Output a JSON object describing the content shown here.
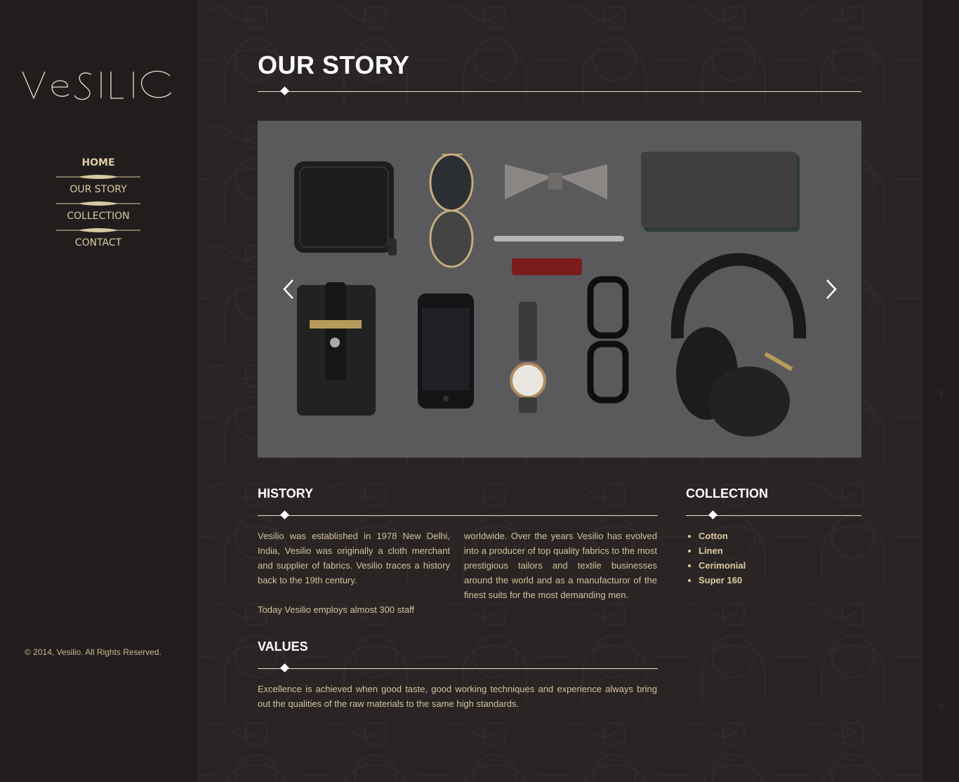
{
  "brand": {
    "logo_text": "VESILIO"
  },
  "nav": {
    "items": [
      {
        "label": "HOME",
        "active": true
      },
      {
        "label": "OUR STORY",
        "active": false
      },
      {
        "label": "COLLECTION",
        "active": false
      },
      {
        "label": "CONTACT",
        "active": false
      }
    ]
  },
  "footer": {
    "copyright": "© 2014, Vesilio. All Rights Reserved."
  },
  "page": {
    "title": "OUR STORY"
  },
  "slider": {
    "prev_icon": "chevron-left-icon",
    "next_icon": "chevron-right-icon"
  },
  "history": {
    "heading": "HISTORY",
    "col1": "Vesilio was established in 1978 New Delhi, India, Vesilio was originally a cloth merchant and supplier of fabrics. Vesilio traces a history back to the 19th century.",
    "col1b": "Today Vesilio employs almost 300 staff",
    "col2": "worldwide. Over the years Vesilio has evolved into a producer of top quality fabrics to the most prestigious tailors and textile businesses around the world and as a manufacturor of the finest suits for the most demanding men."
  },
  "collection": {
    "heading": "COLLECTION",
    "items": [
      "Cotton",
      "Linen",
      "Cerimonial",
      "Super 160"
    ]
  },
  "values": {
    "heading": "VALUES",
    "text": "Excellence is achieved when good taste, good working techniques and experience always bring out the qualities of the raw materials to the same high standards."
  },
  "colors": {
    "sidebar_bg": "#221d1d",
    "main_bg": "#2a2424",
    "accent_gold": "#d8c9a3",
    "heading_white": "#ffffff"
  }
}
